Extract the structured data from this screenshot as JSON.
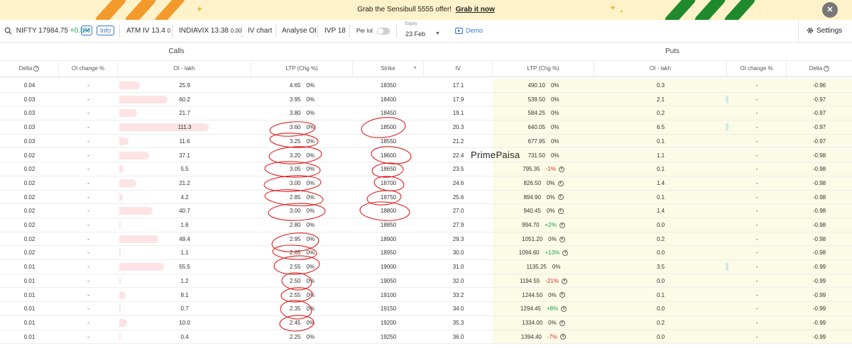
{
  "banner": {
    "text": "Grab the Sensibull 5555 offer!",
    "link": "Grab it now",
    "close_icon": "close-icon"
  },
  "toolbar": {
    "symbol": "NIFTY",
    "spot": "17984.75",
    "change": "+0.8%",
    "info_label": "Info",
    "atm_iv": "ATM IV 13.4",
    "atm_iv_chg": "0",
    "indiavix_label": "INDIAVIX",
    "indiavix_value": "13.38",
    "indiavix_chg": "0.00",
    "iv_chart": "IV chart",
    "analyse_oi": "Analyse OI",
    "ivp": "IVP 18",
    "per_lot": "Per lot",
    "expiry_label": "Expiry",
    "expiry_value": "23 Feb",
    "demo": "Demo",
    "settings": "Settings"
  },
  "sections": {
    "calls": "Calls",
    "puts": "Puts"
  },
  "headers": [
    "Delta",
    "OI change %",
    "OI - lakh",
    "LTP (Chg %)",
    "Strike",
    "IV",
    "LTP (Chg %)",
    "OI - lakh",
    "OI change %",
    "Delta"
  ],
  "watermark": "PrimePaisa",
  "colors": {
    "accent": "#3a76d8",
    "positive": "#1aa34a",
    "negative": "#d33333",
    "itm_bg": "#fbfbe6",
    "oi_bar": "#fde3e3",
    "annotation": "#e02020"
  },
  "rows": [
    {
      "c_delta": "0.04",
      "c_oichg": "-",
      "c_oi": "25.9",
      "c_ltp": "4.65",
      "c_chg": "0%",
      "strike": "18350",
      "iv": "17.1",
      "p_ltp": "490.10",
      "p_chg": "0%",
      "p_oi": "0.3",
      "p_oichg": "-",
      "p_delta": "-0.96",
      "badge": false,
      "c_bar": 0.23,
      "p_bar": false
    },
    {
      "c_delta": "0.03",
      "c_oichg": "-",
      "c_oi": "60.2",
      "c_ltp": "3.95",
      "c_chg": "0%",
      "strike": "18400",
      "iv": "17.9",
      "p_ltp": "539.50",
      "p_chg": "0%",
      "p_oi": "2.1",
      "p_oichg": "-",
      "p_delta": "-0.97",
      "badge": false,
      "c_bar": 0.54,
      "p_bar": true
    },
    {
      "c_delta": "0.03",
      "c_oichg": "-",
      "c_oi": "21.7",
      "c_ltp": "3.80",
      "c_chg": "0%",
      "strike": "18450",
      "iv": "19.1",
      "p_ltp": "584.25",
      "p_chg": "0%",
      "p_oi": "0.2",
      "p_oichg": "-",
      "p_delta": "-0.97",
      "badge": false,
      "c_bar": 0.2,
      "p_bar": false
    },
    {
      "c_delta": "0.03",
      "c_oichg": "-",
      "c_oi": "111.3",
      "c_ltp": "3.60",
      "c_chg": "0%",
      "strike": "18500",
      "iv": "20.3",
      "p_ltp": "640.05",
      "p_chg": "0%",
      "p_oi": "6.5",
      "p_oichg": "-",
      "p_delta": "-0.97",
      "badge": false,
      "c_bar": 1.0,
      "p_bar": true
    },
    {
      "c_delta": "0.03",
      "c_oichg": "-",
      "c_oi": "11.6",
      "c_ltp": "3.25",
      "c_chg": "0%",
      "strike": "18550",
      "iv": "21.2",
      "p_ltp": "677.95",
      "p_chg": "0%",
      "p_oi": "0.1",
      "p_oichg": "-",
      "p_delta": "-0.97",
      "badge": false,
      "c_bar": 0.1,
      "p_bar": false
    },
    {
      "c_delta": "0.02",
      "c_oichg": "-",
      "c_oi": "37.1",
      "c_ltp": "3.20",
      "c_chg": "0%",
      "strike": "18600",
      "iv": "22.4",
      "p_ltp": "731.50",
      "p_chg": "0%",
      "p_oi": "1.1",
      "p_oichg": "-",
      "p_delta": "-0.98",
      "badge": false,
      "c_bar": 0.33,
      "p_bar": false
    },
    {
      "c_delta": "0.02",
      "c_oichg": "-",
      "c_oi": "5.5",
      "c_ltp": "3.05",
      "c_chg": "0%",
      "strike": "18650",
      "iv": "23.5",
      "p_ltp": "795.35",
      "p_chg": "-1%",
      "p_oi": "0.1",
      "p_oichg": "-",
      "p_delta": "-0.98",
      "badge": true,
      "c_bar": 0.05,
      "p_bar": false
    },
    {
      "c_delta": "0.02",
      "c_oichg": "-",
      "c_oi": "21.2",
      "c_ltp": "3.00",
      "c_chg": "0%",
      "strike": "18700",
      "iv": "24.6",
      "p_ltp": "826.50",
      "p_chg": "0%",
      "p_oi": "1.4",
      "p_oichg": "-",
      "p_delta": "-0.98",
      "badge": true,
      "c_bar": 0.19,
      "p_bar": false
    },
    {
      "c_delta": "0.02",
      "c_oichg": "-",
      "c_oi": "4.2",
      "c_ltp": "2.85",
      "c_chg": "0%",
      "strike": "18750",
      "iv": "25.6",
      "p_ltp": "894.90",
      "p_chg": "0%",
      "p_oi": "0.1",
      "p_oichg": "-",
      "p_delta": "-0.98",
      "badge": true,
      "c_bar": 0.04,
      "p_bar": false
    },
    {
      "c_delta": "0.02",
      "c_oichg": "-",
      "c_oi": "40.7",
      "c_ltp": "3.00",
      "c_chg": "0%",
      "strike": "18800",
      "iv": "27.0",
      "p_ltp": "940.45",
      "p_chg": "0%",
      "p_oi": "1.4",
      "p_oichg": "-",
      "p_delta": "-0.98",
      "badge": true,
      "c_bar": 0.37,
      "p_bar": false
    },
    {
      "c_delta": "0.02",
      "c_oichg": "-",
      "c_oi": "1.6",
      "c_ltp": "2.80",
      "c_chg": "0%",
      "strike": "18850",
      "iv": "27.9",
      "p_ltp": "994.70",
      "p_chg": "+2%",
      "p_oi": "0.0",
      "p_oichg": "-",
      "p_delta": "-0.98",
      "badge": true,
      "c_bar": 0.015,
      "p_bar": false
    },
    {
      "c_delta": "0.02",
      "c_oichg": "-",
      "c_oi": "49.4",
      "c_ltp": "2.95",
      "c_chg": "0%",
      "strike": "18900",
      "iv": "29.3",
      "p_ltp": "1051.20",
      "p_chg": "0%",
      "p_oi": "0.2",
      "p_oichg": "-",
      "p_delta": "-0.98",
      "badge": true,
      "c_bar": 0.44,
      "p_bar": false
    },
    {
      "c_delta": "0.02",
      "c_oichg": "-",
      "c_oi": "1.1",
      "c_ltp": "2.65",
      "c_chg": "0%",
      "strike": "18950",
      "iv": "30.0",
      "p_ltp": "1094.60",
      "p_chg": "+13%",
      "p_oi": "0.0",
      "p_oichg": "-",
      "p_delta": "-0.98",
      "badge": true,
      "c_bar": 0.01,
      "p_bar": false
    },
    {
      "c_delta": "0.01",
      "c_oichg": "-",
      "c_oi": "55.5",
      "c_ltp": "2.55",
      "c_chg": "0%",
      "strike": "19000",
      "iv": "31.0",
      "p_ltp": "1135.25",
      "p_chg": "0%",
      "p_oi": "3.5",
      "p_oichg": "-",
      "p_delta": "-0.99",
      "badge": false,
      "c_bar": 0.5,
      "p_bar": true
    },
    {
      "c_delta": "0.01",
      "c_oichg": "-",
      "c_oi": "1.2",
      "c_ltp": "2.50",
      "c_chg": "0%",
      "strike": "19050",
      "iv": "32.0",
      "p_ltp": "1194.55",
      "p_chg": "-21%",
      "p_oi": "0.0",
      "p_oichg": "-",
      "p_delta": "-0.99",
      "badge": true,
      "c_bar": 0.01,
      "p_bar": false
    },
    {
      "c_delta": "0.01",
      "c_oichg": "-",
      "c_oi": "8.1",
      "c_ltp": "2.55",
      "c_chg": "0%",
      "strike": "19100",
      "iv": "33.2",
      "p_ltp": "1244.50",
      "p_chg": "0%",
      "p_oi": "0.1",
      "p_oichg": "-",
      "p_delta": "-0.99",
      "badge": true,
      "c_bar": 0.07,
      "p_bar": false
    },
    {
      "c_delta": "0.01",
      "c_oichg": "-",
      "c_oi": "0.7",
      "c_ltp": "2.35",
      "c_chg": "0%",
      "strike": "19150",
      "iv": "34.0",
      "p_ltp": "1294.45",
      "p_chg": "+8%",
      "p_oi": "0.0",
      "p_oichg": "-",
      "p_delta": "-0.99",
      "badge": true,
      "c_bar": 0.006,
      "p_bar": false
    },
    {
      "c_delta": "0.01",
      "c_oichg": "-",
      "c_oi": "10.0",
      "c_ltp": "2.45",
      "c_chg": "0%",
      "strike": "19200",
      "iv": "35.3",
      "p_ltp": "1334.00",
      "p_chg": "0%",
      "p_oi": "0.2",
      "p_oichg": "-",
      "p_delta": "-0.99",
      "badge": true,
      "c_bar": 0.09,
      "p_bar": false
    },
    {
      "c_delta": "0.01",
      "c_oichg": "-",
      "c_oi": "0.4",
      "c_ltp": "2.25",
      "c_chg": "0%",
      "strike": "19250",
      "iv": "36.0",
      "p_ltp": "1394.40",
      "p_chg": "-7%",
      "p_oi": "0.0",
      "p_oichg": "-",
      "p_delta": "-0.99",
      "badge": true,
      "c_bar": 0.004,
      "p_bar": false
    }
  ]
}
